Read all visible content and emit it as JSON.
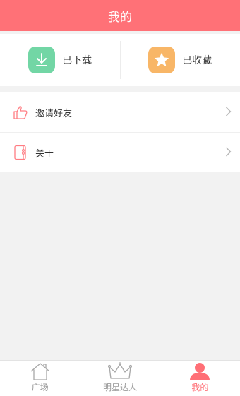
{
  "header": {
    "title": "我的"
  },
  "stats": {
    "downloaded": {
      "label": "已下载",
      "icon": "download-icon",
      "color": "#72d6a5"
    },
    "favorited": {
      "label": "已收藏",
      "icon": "star-icon",
      "color": "#f8b667"
    }
  },
  "menu": {
    "items": [
      {
        "label": "邀请好友",
        "icon": "thumbs-up-icon"
      },
      {
        "label": "关于",
        "icon": "notebook-icon"
      }
    ]
  },
  "tabbar": {
    "items": [
      {
        "label": "广场",
        "icon": "house-icon"
      },
      {
        "label": "明星达人",
        "icon": "crown-icon"
      },
      {
        "label": "我的",
        "icon": "person-icon",
        "active": true
      }
    ],
    "active_color": "#ff6f76"
  },
  "colors": {
    "accent": "#ff7177"
  }
}
